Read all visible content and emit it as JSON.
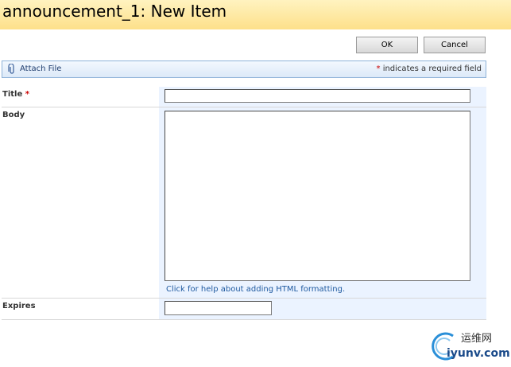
{
  "header": {
    "title": "announcement_1: New Item"
  },
  "actions": {
    "ok_label": "OK",
    "cancel_label": "Cancel"
  },
  "toolbar": {
    "attach_label": "Attach File",
    "required_star": "*",
    "required_note": " indicates a required field"
  },
  "form": {
    "title_label": "Title",
    "title_required_star": "*",
    "title_value": "",
    "body_label": "Body",
    "body_value": "",
    "body_help": "Click for help about adding HTML formatting.",
    "expires_label": "Expires",
    "expires_value": ""
  },
  "watermark": {
    "line1": "运维网",
    "line2": "iyunv.com"
  },
  "colors": {
    "accent_link": "#1f5aa0",
    "required": "#cc0000",
    "field_bg": "#ebf3ff"
  }
}
